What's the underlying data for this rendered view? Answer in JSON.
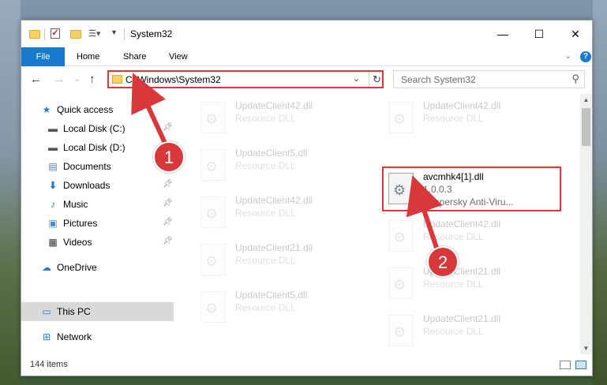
{
  "window": {
    "title": "System32",
    "minimize_icon": "minimize-icon",
    "maximize_icon": "maximize-icon",
    "close_icon": "close-icon"
  },
  "ribbon": {
    "tabs": [
      "File",
      "Home",
      "Share",
      "View"
    ],
    "expand_glyph": "⌄",
    "help_glyph": "?"
  },
  "nav": {
    "back_glyph": "←",
    "forward_glyph": "→",
    "recent_glyph": "⌄",
    "up_glyph": "↑",
    "address": "C:\\Windows\\System32",
    "address_dropdown_glyph": "⌄",
    "refresh_glyph": "↻",
    "search_placeholder": "Search System32",
    "search_glyph": "⚲"
  },
  "sidebar": {
    "items": [
      {
        "label": "Quick access",
        "icon": "star-icon",
        "pinned": false
      },
      {
        "label": "Local Disk (C:)",
        "icon": "drive-icon",
        "pinned": true
      },
      {
        "label": "Local Disk (D:)",
        "icon": "drive-icon",
        "pinned": false
      },
      {
        "label": "Documents",
        "icon": "documents-icon",
        "pinned": true
      },
      {
        "label": "Downloads",
        "icon": "download-icon",
        "pinned": true
      },
      {
        "label": "Music",
        "icon": "music-icon",
        "pinned": true
      },
      {
        "label": "Pictures",
        "icon": "pictures-icon",
        "pinned": true
      },
      {
        "label": "Videos",
        "icon": "videos-icon",
        "pinned": true
      },
      {
        "label": "OneDrive",
        "icon": "cloud-icon",
        "pinned": false
      },
      {
        "label": "This PC",
        "icon": "computer-icon",
        "pinned": false,
        "selected": true
      },
      {
        "label": "Network",
        "icon": "network-icon",
        "pinned": false
      }
    ]
  },
  "files": {
    "col1": [
      {
        "name": "UpdateClient42.dll",
        "type": "Resource DLL"
      },
      {
        "name": "UpdateClient5.dll",
        "type": "Resource DLL"
      },
      {
        "name": "UpdateClient42.dll",
        "type": "Resource DLL"
      },
      {
        "name": "UpdateClient21.dll",
        "type": "Resource DLL"
      },
      {
        "name": "UpdateClient5.dll",
        "type": "Resource DLL"
      }
    ],
    "col2": [
      {
        "name": "UpdateClient42.dll",
        "type": "Resource DLL"
      },
      {
        "name": "UpdateClient42.dll",
        "type": "Resource DLL"
      },
      {
        "name": "UpdateClient21.dll",
        "type": "Resource DLL"
      },
      {
        "name": "UpdateClient21.dll",
        "type": "Resource DLL"
      }
    ],
    "highlighted": {
      "name": "avcmhk4[1].dll",
      "version": "1.0.0.3",
      "company": "Kaspersky Anti-Viru..."
    }
  },
  "status": {
    "item_count": "144 items"
  },
  "annotations": {
    "step1": "1",
    "step2": "2",
    "color": "#d8383b"
  }
}
